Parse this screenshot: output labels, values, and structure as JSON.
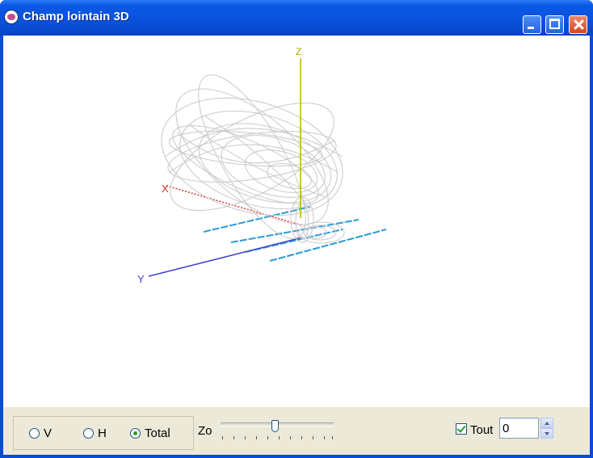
{
  "window": {
    "title": "Champ lointain 3D"
  },
  "plot": {
    "axis_labels": {
      "z": "Z",
      "x": "X",
      "y": "Y"
    },
    "colors": {
      "z_axis": "#b0b800",
      "x_axis": "#e03030",
      "y_axis": "#4444cc",
      "array_lines": "#2a9ad6",
      "mesh": "#c8c8c8"
    }
  },
  "controls": {
    "polarization": {
      "options": [
        {
          "label": "V",
          "selected": false
        },
        {
          "label": "H",
          "selected": false
        },
        {
          "label": "Total",
          "selected": true
        }
      ]
    },
    "zoom": {
      "label": "Zo",
      "level": 0.48
    },
    "tout": {
      "label": "Tout",
      "checked": true
    },
    "spin_value": "0"
  },
  "icons": [
    "app-icon",
    "minimize-icon",
    "maximize-icon",
    "close-icon",
    "spin-up-icon",
    "spin-down-icon"
  ]
}
